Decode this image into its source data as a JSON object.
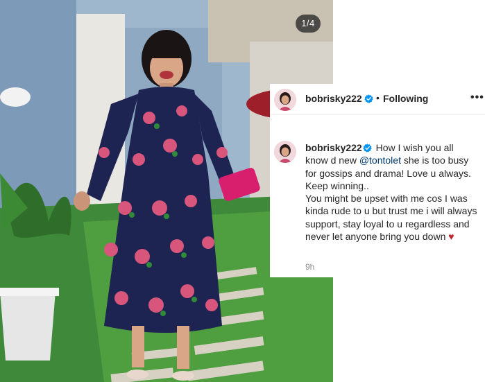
{
  "photo": {
    "counter": "1/4"
  },
  "post": {
    "header": {
      "username": "bobrisky222",
      "separator": "•",
      "follow_status": "Following",
      "more_label": "•••"
    },
    "caption": {
      "username": "bobrisky222",
      "text_before_mention": "How I wish you all know d new",
      "mention": "@tontolet",
      "text_after_mention": "she is too busy for gossips and drama! Love u always. Keep winning..",
      "line2": "You might be upset with me cos I was kinda rude to u but trust me i will always support, stay loyal to u regardless and never let anyone bring you down",
      "heart": "♥"
    },
    "timestamp": "9h"
  },
  "colors": {
    "text": "#262626",
    "verified": "#0095f6",
    "mention": "#00376b",
    "muted": "#8e8e8e",
    "heart": "#c0262d"
  },
  "icons": [
    "verified-badge-icon",
    "more-options-icon",
    "heart-emoji-icon"
  ]
}
